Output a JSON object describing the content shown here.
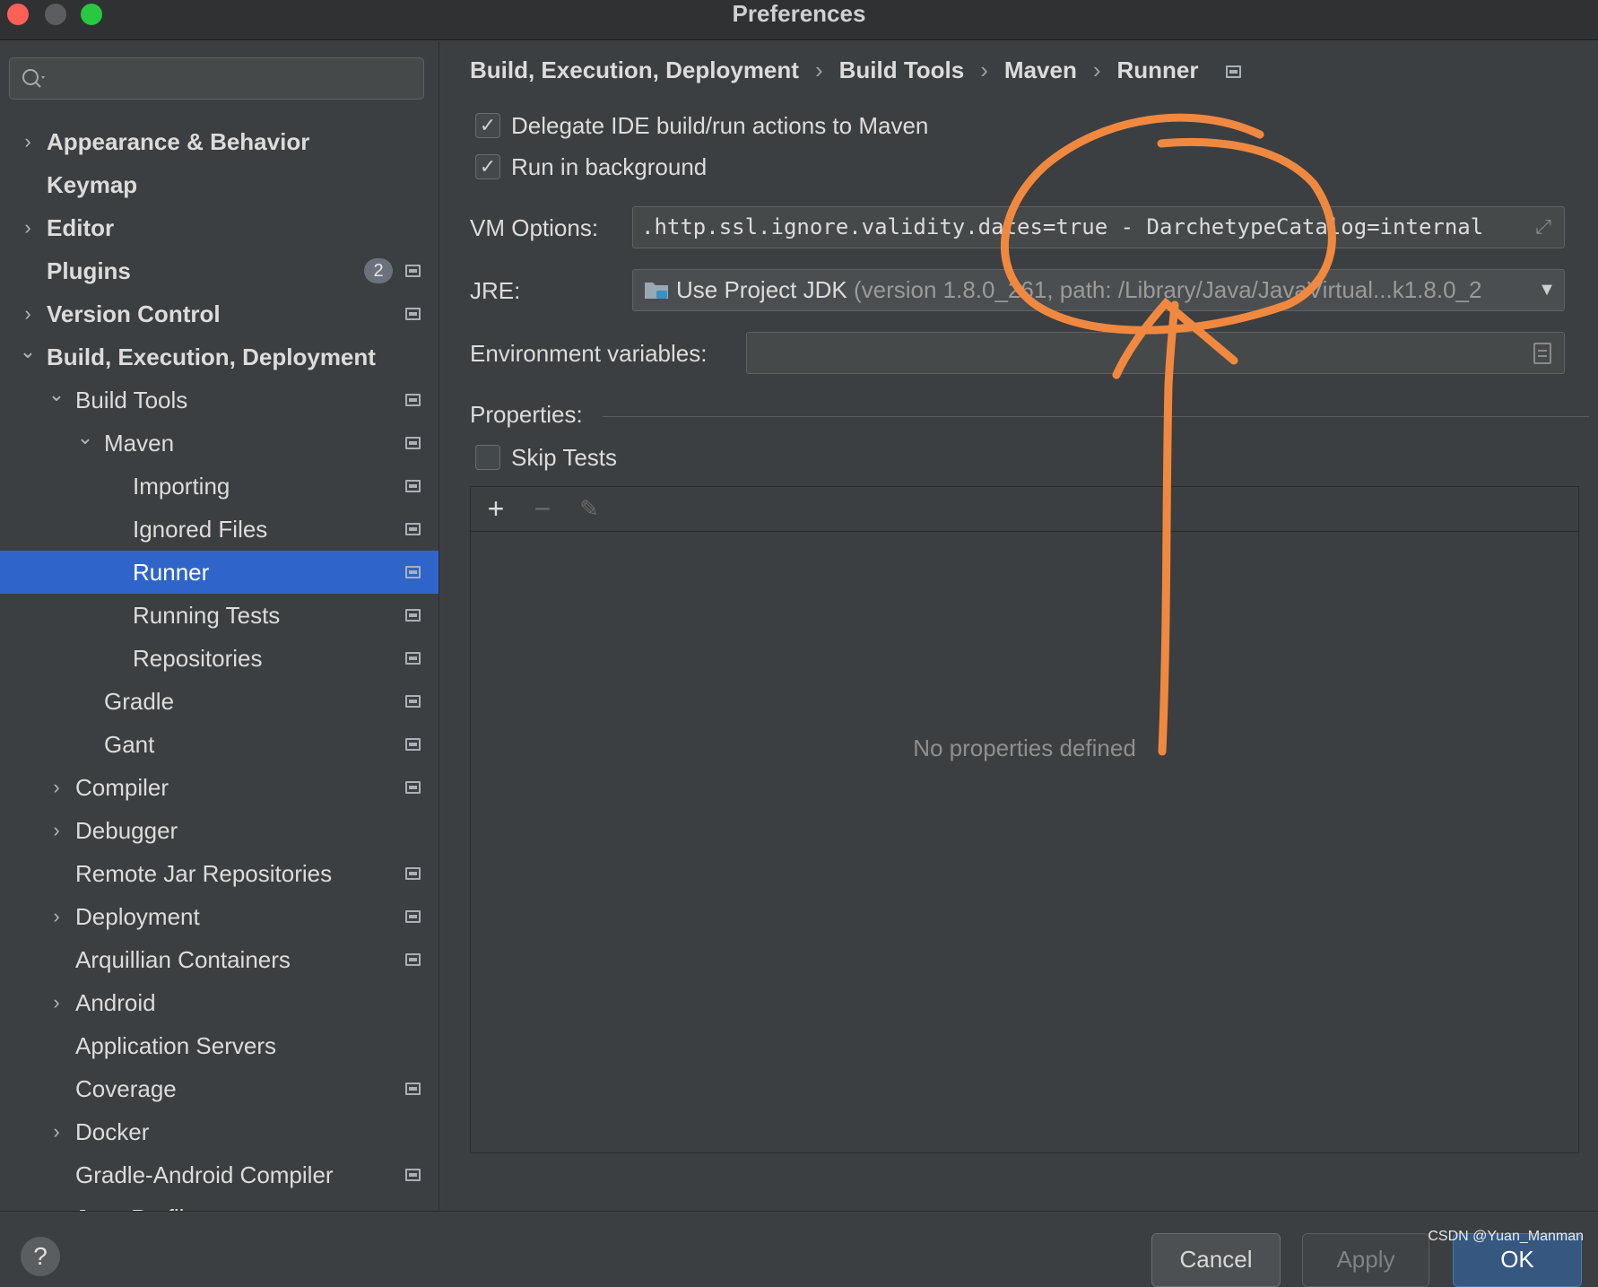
{
  "window": {
    "title": "Preferences"
  },
  "search": {
    "placeholder": ""
  },
  "sidebar": {
    "items": [
      {
        "label": "Appearance & Behavior",
        "bold": true,
        "chevron": "right"
      },
      {
        "label": "Keymap",
        "bold": true,
        "chevron": ""
      },
      {
        "label": "Editor",
        "bold": true,
        "chevron": "right"
      },
      {
        "label": "Plugins",
        "bold": true,
        "chevron": "",
        "badge": "2"
      },
      {
        "label": "Version Control",
        "bold": true,
        "chevron": "right"
      },
      {
        "label": "Build, Execution, Deployment",
        "bold": true,
        "chevron": "down"
      },
      {
        "label": "Build Tools",
        "chevron": "down"
      },
      {
        "label": "Maven",
        "chevron": "down"
      },
      {
        "label": "Importing"
      },
      {
        "label": "Ignored Files"
      },
      {
        "label": "Runner",
        "selected": true
      },
      {
        "label": "Running Tests"
      },
      {
        "label": "Repositories"
      },
      {
        "label": "Gradle"
      },
      {
        "label": "Gant"
      },
      {
        "label": "Compiler",
        "chevron": "right"
      },
      {
        "label": "Debugger",
        "chevron": "right"
      },
      {
        "label": "Remote Jar Repositories"
      },
      {
        "label": "Deployment",
        "chevron": "right"
      },
      {
        "label": "Arquillian Containers"
      },
      {
        "label": "Android",
        "chevron": "right"
      },
      {
        "label": "Application Servers"
      },
      {
        "label": "Coverage"
      },
      {
        "label": "Docker",
        "chevron": "right"
      },
      {
        "label": "Gradle-Android Compiler"
      },
      {
        "label": "Java Profiler",
        "chevron": "right"
      }
    ]
  },
  "breadcrumb": [
    "Build, Execution, Deployment",
    "Build Tools",
    "Maven",
    "Runner"
  ],
  "options": {
    "delegate_label": "Delegate IDE build/run actions to Maven",
    "delegate_checked": true,
    "background_label": "Run in background",
    "background_checked": true,
    "vm_label": "VM Options:",
    "vm_value": ".http.ssl.ignore.validity.dates=true - DarchetypeCatalog=internal",
    "jre_label": "JRE:",
    "jre_value": "Use Project JDK",
    "jre_detail": " (version 1.8.0_261, path: /Library/Java/JavaVirtual...k1.8.0_2",
    "env_label": "Environment variables:",
    "env_value": ""
  },
  "properties": {
    "label": "Properties:",
    "skip_tests_label": "Skip Tests",
    "skip_tests_checked": false,
    "empty_text": "No properties defined"
  },
  "buttons": {
    "help": "?",
    "cancel": "Cancel",
    "apply": "Apply",
    "ok": "OK"
  },
  "watermark": "CSDN @Yuan_Manman",
  "colors": {
    "selection": "#2f65ca",
    "annotation": "#f0893f",
    "ok_button": "#365880"
  }
}
